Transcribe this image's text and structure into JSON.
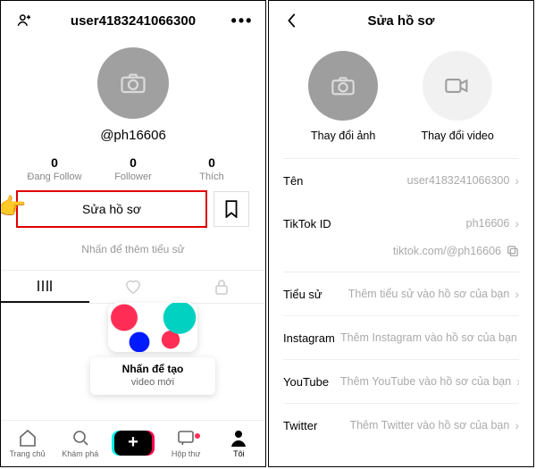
{
  "left": {
    "header": {
      "username": "user4183241066300"
    },
    "handle": "@ph16606",
    "stats": {
      "following": {
        "count": "0",
        "label": "Đang Follow"
      },
      "followers": {
        "count": "0",
        "label": "Follower"
      },
      "likes": {
        "count": "0",
        "label": "Thích"
      }
    },
    "edit_label": "Sửa hồ sơ",
    "bio_hint": "Nhấn để thêm tiểu sử",
    "promo": {
      "line1": "Nhấn để tạo",
      "line2": "video mới"
    },
    "nav": {
      "home": "Trang chủ",
      "discover": "Khám phá",
      "inbox": "Hộp thư",
      "me": "Tôi"
    }
  },
  "right": {
    "title": "Sửa hồ sơ",
    "change_photo": "Thay đổi ảnh",
    "change_video": "Thay đổi video",
    "rows": {
      "name": {
        "k": "Tên",
        "v": "user4183241066300"
      },
      "tiktok": {
        "k": "TikTok ID",
        "v": "ph16606"
      },
      "link": {
        "v": "tiktok.com/@ph16606"
      },
      "bio": {
        "k": "Tiểu sử",
        "v": "Thêm tiểu sử vào hồ sơ của bạn"
      },
      "ig": {
        "k": "Instagram",
        "v": "Thêm Instagram vào hồ sơ của bạn"
      },
      "yt": {
        "k": "YouTube",
        "v": "Thêm YouTube vào hồ sơ của bạn"
      },
      "tw": {
        "k": "Twitter",
        "v": "Thêm Twitter vào hồ sơ của bạn"
      }
    }
  }
}
